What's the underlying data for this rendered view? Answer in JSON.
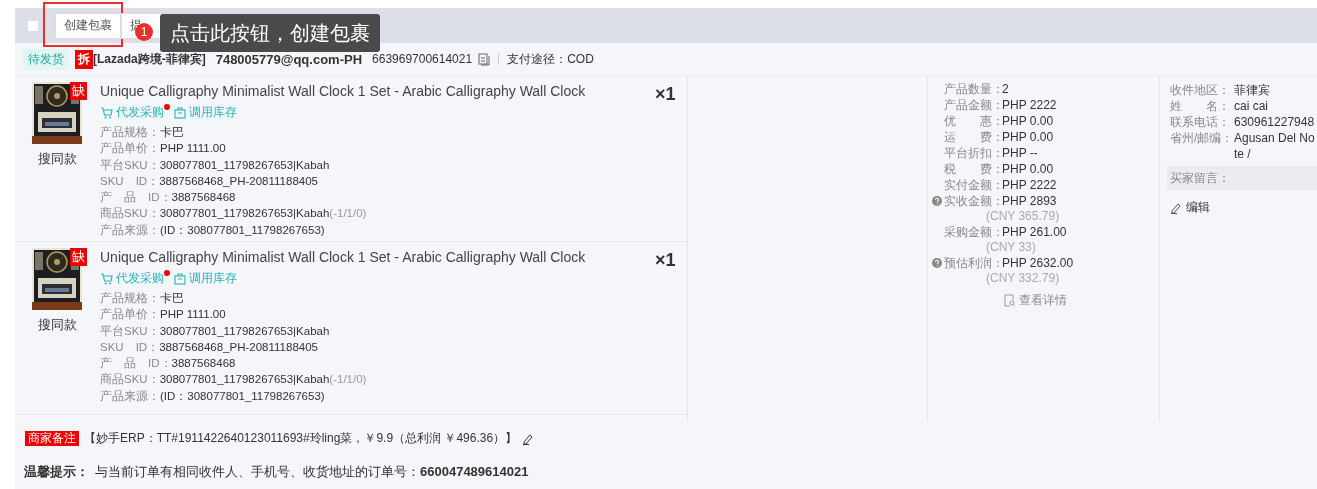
{
  "toolbar": {
    "checkbox": {
      "checked": false
    },
    "buttons": [
      {
        "label": "创建包裹",
        "highlighted": true
      },
      {
        "label": "提",
        "highlighted": false
      }
    ],
    "guide": {
      "step": "1",
      "text": "点击此按钮，创建包裹"
    }
  },
  "order": {
    "status": "待发货",
    "split_badge": "拆",
    "shop": "[Lazada跨境-菲律宾]",
    "account": "748005779@qq.com-PH",
    "order_no": "663969700614021",
    "payment": "支付途径：COD"
  },
  "items": [
    {
      "badge": "缺",
      "title": "Unique Calligraphy Minimalist Wall Clock 1 Set - Arabic Calligraphy Wall Clock",
      "quantity": "×1",
      "similar": "搜同款",
      "actions": [
        {
          "kind": "cart",
          "label": "代发采购",
          "dot": true
        },
        {
          "kind": "bag",
          "label": "调用库存",
          "dot": false
        }
      ],
      "fields": [
        {
          "label": "产品规格：",
          "value": "卡巴"
        },
        {
          "label": "产品单价：",
          "value": "PHP 1111.00"
        },
        {
          "label": "平台SKU：",
          "value": "308077801_11798267653|Kabah"
        },
        {
          "label": "SKU　ID：",
          "value": "3887568468_PH-20811188405"
        },
        {
          "label": "产　品　ID：",
          "value": "3887568468"
        },
        {
          "label": "商品SKU：",
          "value": "308077801_11798267653|Kabah",
          "note": "(-1/1/0)"
        },
        {
          "label": "产品来源：",
          "value": "(ID：308077801_11798267653)"
        }
      ]
    },
    {
      "badge": "缺",
      "title": "Unique Calligraphy Minimalist Wall Clock 1 Set - Arabic Calligraphy Wall Clock",
      "quantity": "×1",
      "similar": "搜同款",
      "actions": [
        {
          "kind": "cart",
          "label": "代发采购",
          "dot": true
        },
        {
          "kind": "bag",
          "label": "调用库存",
          "dot": false
        }
      ],
      "fields": [
        {
          "label": "产品规格：",
          "value": "卡巴"
        },
        {
          "label": "产品单价：",
          "value": "PHP 1111.00"
        },
        {
          "label": "平台SKU：",
          "value": "308077801_11798267653|Kabah"
        },
        {
          "label": "SKU　ID：",
          "value": "3887568468_PH-20811188405"
        },
        {
          "label": "产　品　ID：",
          "value": "3887568468"
        },
        {
          "label": "商品SKU：",
          "value": "308077801_11798267653|Kabah",
          "note": "(-1/1/0)"
        },
        {
          "label": "产品来源：",
          "value": "(ID：308077801_11798267653)"
        }
      ]
    }
  ],
  "amounts": {
    "rows": [
      {
        "label": "产品数量：",
        "value": "2",
        "help": false
      },
      {
        "label": "产品金额：",
        "value": "PHP 2222",
        "help": false
      },
      {
        "label": "优　　惠：",
        "value": "PHP 0.00",
        "help": false
      },
      {
        "label": "运　　费：",
        "value": "PHP 0.00",
        "help": false
      },
      {
        "label": "平台折扣：",
        "value": "PHP --",
        "help": false
      },
      {
        "label": "税　　费：",
        "value": "PHP 0.00",
        "help": false
      },
      {
        "label": "实付金额：",
        "value": "PHP 2222",
        "help": false
      },
      {
        "label": "实收金额：",
        "value": "PHP 2893",
        "help": true,
        "sub": "(CNY 365.79)"
      },
      {
        "label": "采购金额：",
        "value": "PHP 261.00",
        "help": false,
        "sub": "(CNY 33)"
      },
      {
        "label": "预估利润：",
        "value": "PHP 2632.00",
        "help": true,
        "sub": "(CNY 332.79)"
      }
    ],
    "details_link": "查看详情"
  },
  "recipient": {
    "rows": [
      {
        "label": "收件地区：",
        "value": "菲律宾"
      },
      {
        "label": "姓　　名：",
        "value": "cai cai"
      },
      {
        "label": "联系电话：",
        "value": "630961227948"
      },
      {
        "label": "省州/邮编：",
        "value": "Agusan Del No",
        "value_2": "te /"
      }
    ],
    "buyer_message": "买家留言：",
    "edit": "编辑"
  },
  "merchant_note": {
    "tag": "商家备注",
    "text": "【妙手ERP：TT#1911422640123011693#玲ling菜，￥9.9（总利润 ￥496.36）】"
  },
  "tip": {
    "label": "温馨提示：",
    "text": "与当前订单有相同收件人、手机号、收货地址的订单号：",
    "order_no": "660047489614021"
  }
}
